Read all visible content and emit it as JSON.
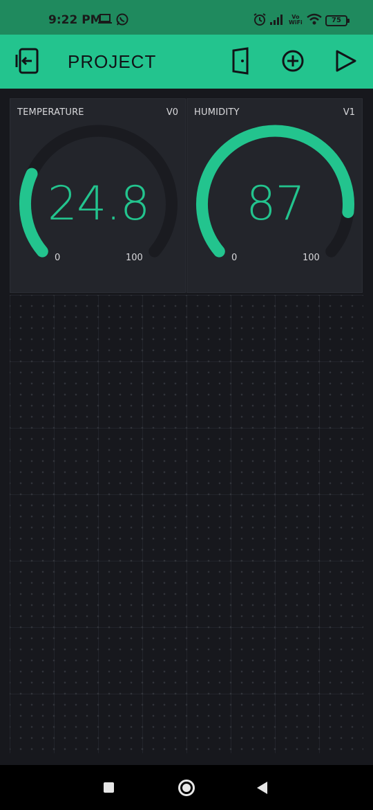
{
  "status_bar": {
    "time": "9:22 PM",
    "network_label_top": "Vo",
    "network_label_bottom": "WiFi",
    "battery": "75",
    "icons": [
      "laptop-icon",
      "whatsapp-icon",
      "alarm-icon",
      "signal-icon",
      "wifi-icon",
      "battery-icon"
    ]
  },
  "header": {
    "title": "PROJECT",
    "icons": [
      "exit-icon",
      "device-icon",
      "add-icon",
      "play-icon"
    ],
    "background": "#23c48e"
  },
  "widgets": [
    {
      "title": "TEMPERATURE",
      "pin": "V0",
      "value": "24.8",
      "fraction": 0.248,
      "min": "0",
      "max": "100"
    },
    {
      "title": "HUMIDITY",
      "pin": "V1",
      "value": "87",
      "fraction": 0.87,
      "min": "0",
      "max": "100"
    }
  ],
  "colors": {
    "accent": "#23c48e",
    "gauge_track": "#1a1b20",
    "widget_bg": "#23252b",
    "canvas_bg": "#17181d"
  },
  "nav_bar": {
    "icons": [
      "recents-icon",
      "home-icon",
      "back-icon"
    ]
  }
}
